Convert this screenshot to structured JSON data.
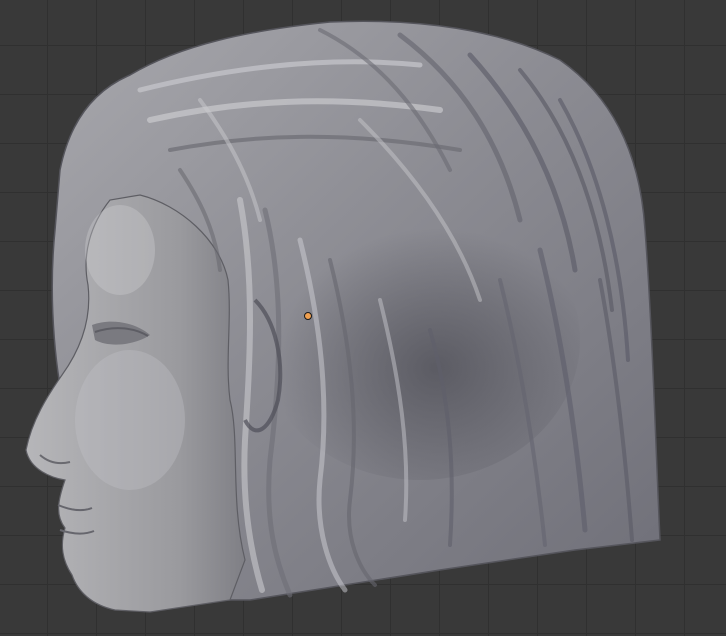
{
  "viewport": {
    "background_color": "#393939",
    "grid_color": "#303030",
    "grid_visible": true
  },
  "mesh": {
    "subject": "sculpted-head-mesh",
    "base_color": "#8f8f94",
    "highlight_color": "#c9c9ce",
    "shadow_color": "#56565e"
  },
  "object_origin": {
    "icon": "object-origin-icon",
    "color": "#f0a050"
  }
}
